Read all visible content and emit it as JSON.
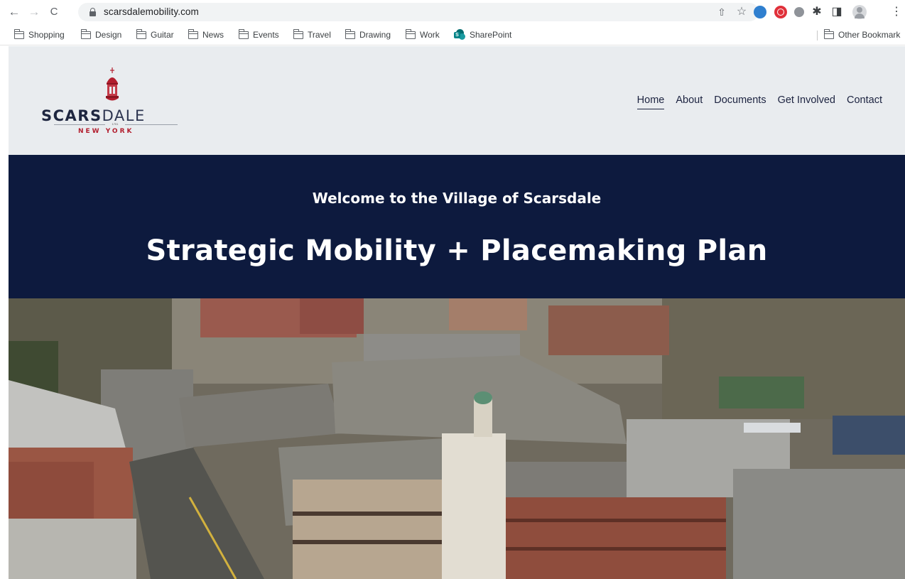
{
  "browser": {
    "back_icon": "←",
    "forward_icon": "→",
    "reload_icon": "C",
    "url": "scarsdalemobility.com",
    "share_icon": "⇧",
    "star_icon": "☆",
    "puzzle_icon": "✱",
    "sidepanel_icon": "◨",
    "menu_icon": "⋮"
  },
  "bookmarks": {
    "items": [
      {
        "label": "Shopping"
      },
      {
        "label": "Design"
      },
      {
        "label": "Guitar"
      },
      {
        "label": "News"
      },
      {
        "label": "Events"
      },
      {
        "label": "Travel"
      },
      {
        "label": "Drawing"
      },
      {
        "label": "Work"
      },
      {
        "label": "SharePoint"
      }
    ],
    "other": "Other Bookmark"
  },
  "site": {
    "logo": {
      "word_part1": "SCARS",
      "word_part2": "DALE",
      "established": "1701",
      "subtitle": "NEW YORK"
    },
    "nav": [
      {
        "label": "Home",
        "active": true
      },
      {
        "label": "About"
      },
      {
        "label": "Documents"
      },
      {
        "label": "Get Involved"
      },
      {
        "label": "Contact"
      }
    ],
    "hero": {
      "subtitle": "Welcome to the Village of Scarsdale",
      "title": "Strategic Mobility + Placemaking Plan"
    },
    "colors": {
      "header_bg": "#e9ecef",
      "hero_bg": "#0d1a3e",
      "brand_navy": "#1e2640",
      "brand_red": "#b21e2e"
    }
  }
}
